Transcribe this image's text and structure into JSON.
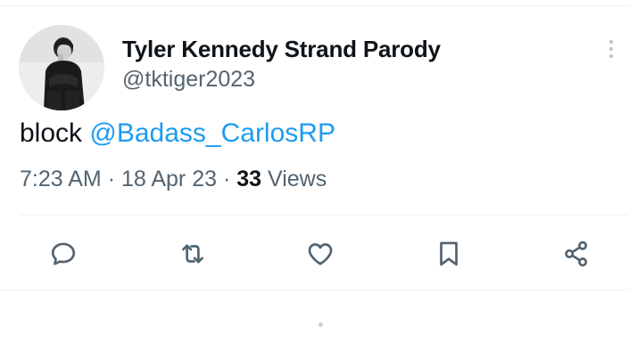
{
  "tweet": {
    "author": {
      "display_name": "Tyler Kennedy Strand Parody",
      "handle": "@tktiger2023"
    },
    "text": "block",
    "mention": "@Badass_CarlosRP",
    "time": "7:23 AM",
    "separator": "·",
    "date": "18 Apr 23",
    "views_count": "33",
    "views_label": "Views"
  },
  "actions": [
    {
      "name": "reply",
      "icon": "speech-bubble-icon"
    },
    {
      "name": "retweet",
      "icon": "retweet-arrows-icon"
    },
    {
      "name": "like",
      "icon": "heart-icon"
    },
    {
      "name": "bookmark",
      "icon": "bookmark-icon"
    },
    {
      "name": "share",
      "icon": "share-icon"
    }
  ],
  "colors": {
    "text": "#0f1419",
    "secondary": "#536471",
    "link": "#1d9bf0",
    "divider": "#eff3f4"
  }
}
